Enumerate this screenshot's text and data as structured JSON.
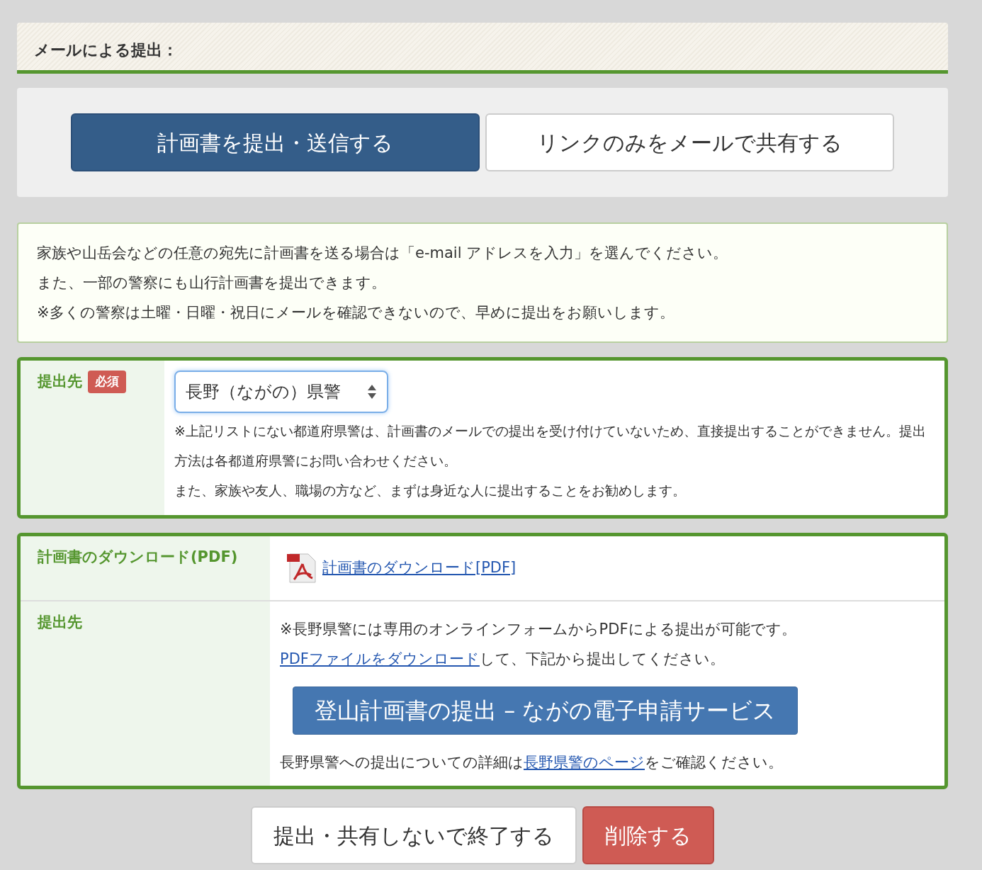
{
  "section_title": "メールによる提出：",
  "mode_tabs": [
    {
      "label": "計画書を提出・送信する",
      "selected": true
    },
    {
      "label": "リンクのみをメールで共有する",
      "selected": false
    }
  ],
  "info_lines": [
    "家族や山岳会などの任意の宛先に計画書を送る場合は「e-mail アドレスを入力」を選んでください。",
    "また、一部の警察にも山行計画書を提出できます。",
    "※多くの警察は土曜・日曜・祝日にメールを確認できないので、早めに提出をお願いします。"
  ],
  "destination_form": {
    "label": "提出先",
    "required_badge": "必須",
    "select_value": "長野（ながの）県警",
    "notes": [
      "※上記リストにない都道府県警は、計画書のメールでの提出を受け付けていないため、直接提出することができません。提出方法は各都道府県警にお問い合わせください。",
      "また、家族や友人、職場の方など、まずは身近な人に提出することをお勧めします。"
    ]
  },
  "pdf_panel": {
    "download_label": "計画書のダウンロード(PDF)",
    "download_link": "計画書のダウンロード[PDF]",
    "destination_label": "提出先",
    "intro": "※長野県警には専用のオンラインフォームからPDFによる提出が可能です。",
    "pdf_link": "PDFファイルをダウンロード",
    "pdf_after": "して、下記から提出してください。",
    "service_button": "登山計画書の提出 – ながの電子申請サービス",
    "detail_before": "長野県警への提出についての詳細は",
    "detail_link": "長野県警のページ",
    "detail_after": "をご確認ください。"
  },
  "footer_buttons": [
    {
      "label": "提出・共有しないで終了する",
      "kind": "default"
    },
    {
      "label": "削除する",
      "kind": "danger"
    }
  ]
}
